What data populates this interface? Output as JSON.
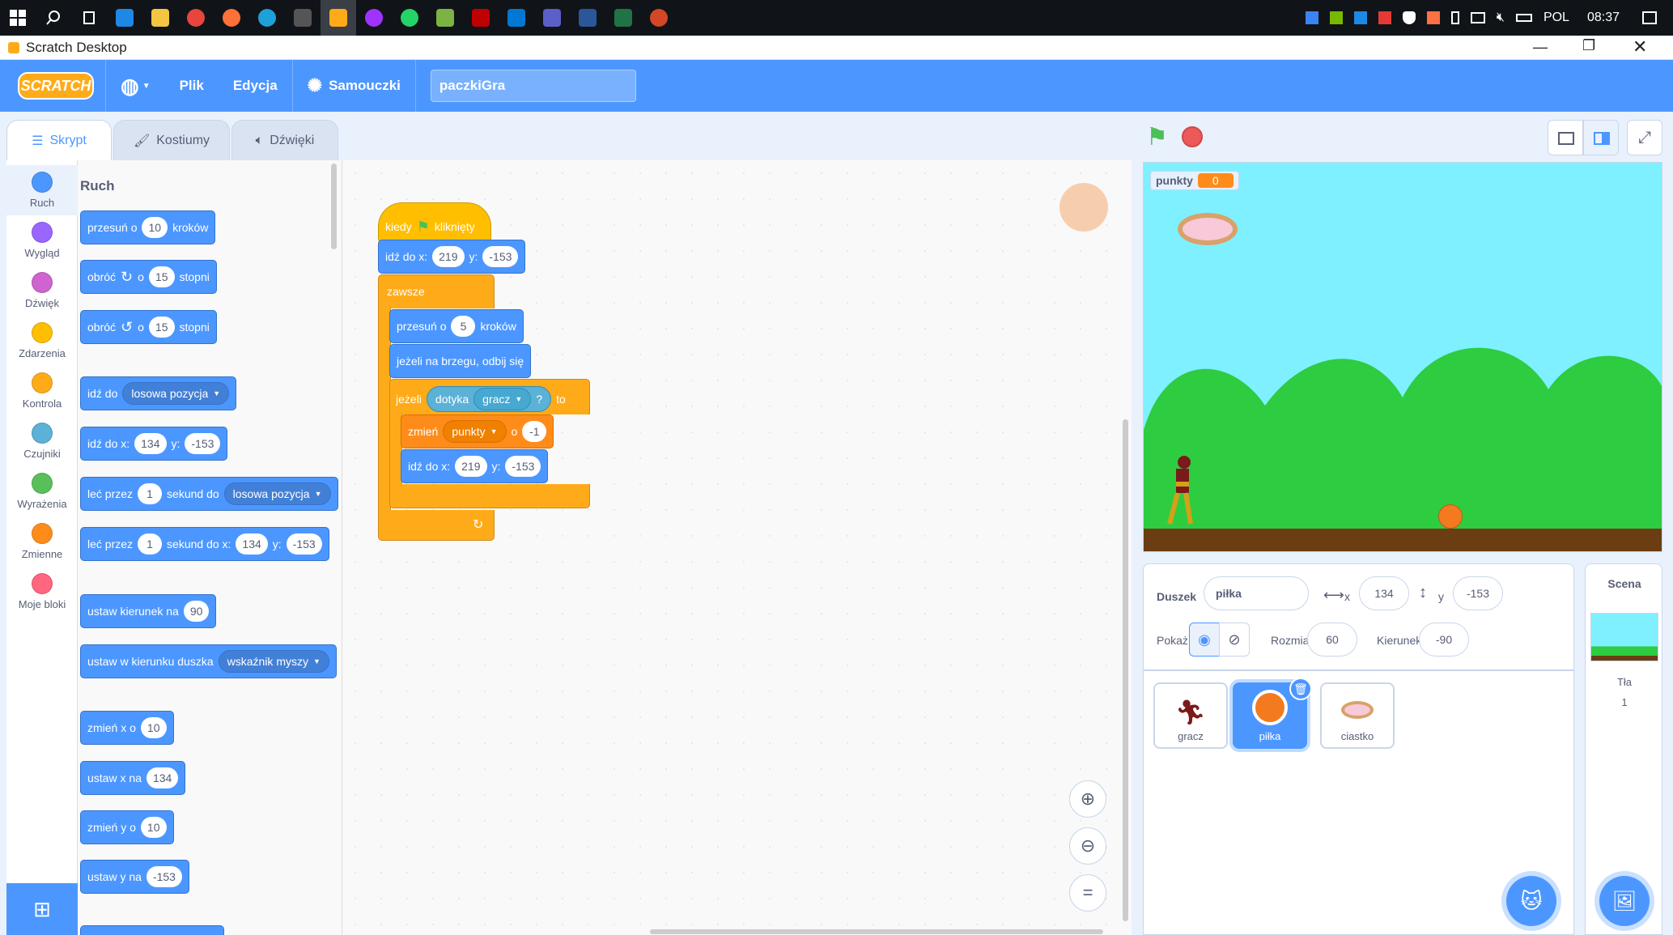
{
  "taskbar": {
    "tray": {
      "lang": "POL",
      "time": "08:37"
    }
  },
  "window": {
    "title": "Scratch Desktop"
  },
  "menu": {
    "logo": "SCRATCH",
    "file": "Plik",
    "edit": "Edycja",
    "tutorials": "Samouczki",
    "project_title": "paczkiGra"
  },
  "tabs": {
    "code": "Skrypt",
    "costumes": "Kostiumy",
    "sounds": "Dźwięki"
  },
  "categories": [
    {
      "label": "Ruch",
      "color": "#4c97ff"
    },
    {
      "label": "Wygląd",
      "color": "#9966ff"
    },
    {
      "label": "Dźwięk",
      "color": "#cf63cf"
    },
    {
      "label": "Zdarzenia",
      "color": "#ffbf00"
    },
    {
      "label": "Kontrola",
      "color": "#ffab19"
    },
    {
      "label": "Czujniki",
      "color": "#5cb1d6"
    },
    {
      "label": "Wyrażenia",
      "color": "#59c059"
    },
    {
      "label": "Zmienne",
      "color": "#ff8c1a"
    },
    {
      "label": "Moje bloki",
      "color": "#ff6680"
    }
  ],
  "palette": {
    "heading": "Ruch",
    "b1": {
      "a": "przesuń o",
      "v": "10",
      "b": "kroków"
    },
    "b2": {
      "a": "obróć",
      "b": "o",
      "v": "15",
      "c": "stopni"
    },
    "b3": {
      "a": "obróć",
      "b": "o",
      "v": "15",
      "c": "stopni"
    },
    "b4": {
      "a": "idź do",
      "dd": "losowa pozycja"
    },
    "b5": {
      "a": "idź do x:",
      "x": "134",
      "b": "y:",
      "y": "-153"
    },
    "b6": {
      "a": "leć przez",
      "v": "1",
      "b": "sekund do",
      "dd": "losowa pozycja"
    },
    "b7": {
      "a": "leć przez",
      "v": "1",
      "b": "sekund do x:",
      "x": "134",
      "c": "y:",
      "y": "-153"
    },
    "b8": {
      "a": "ustaw kierunek na",
      "v": "90"
    },
    "b9": {
      "a": "ustaw w kierunku duszka",
      "dd": "wskaźnik myszy"
    },
    "b10": {
      "a": "zmień x o",
      "v": "10"
    },
    "b11": {
      "a": "ustaw x na",
      "v": "134"
    },
    "b12": {
      "a": "zmień y o",
      "v": "10"
    },
    "b13": {
      "a": "ustaw y na",
      "v": "-153"
    }
  },
  "script": {
    "hat": {
      "a": "kiedy",
      "b": "kliknięty"
    },
    "goto1": {
      "a": "idź do x:",
      "x": "219",
      "b": "y:",
      "y": "-153"
    },
    "forever": "zawsze",
    "move": {
      "a": "przesuń o",
      "v": "5",
      "b": "kroków"
    },
    "bounce": "jeżeli na brzegu, odbij się",
    "if": {
      "a": "jeżeli",
      "sense": "dotyka",
      "dd": "gracz",
      "q": "?",
      "b": "to"
    },
    "change": {
      "a": "zmień",
      "dd": "punkty",
      "b": "o",
      "v": "-1"
    },
    "goto2": {
      "a": "idź do x:",
      "x": "219",
      "b": "y:",
      "y": "-153"
    }
  },
  "stage": {
    "var_name": "punkty",
    "var_value": "0"
  },
  "sprite_info": {
    "sprite_label": "Duszek",
    "sprite_name": "piłka",
    "x_label": "x",
    "x": "134",
    "y_label": "y",
    "y": "-153",
    "show_label": "Pokaż",
    "size_label": "Rozmiar",
    "size": "60",
    "direction_label": "Kierunek",
    "direction": "-90"
  },
  "sprites": [
    {
      "name": "gracz"
    },
    {
      "name": "piłka"
    },
    {
      "name": "ciastko"
    }
  ],
  "scene": {
    "title": "Scena",
    "backdrops_label": "Tła",
    "backdrops_count": "1"
  }
}
